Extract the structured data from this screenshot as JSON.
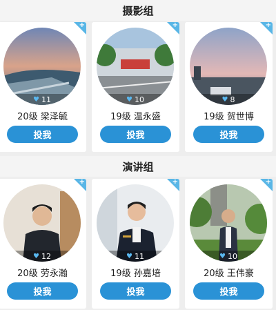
{
  "sections": [
    {
      "title": "摄影组",
      "cards": [
        {
          "likes": "11",
          "name": "20级 梁泽毓",
          "vote_label": "投我"
        },
        {
          "likes": "10",
          "name": "19级 温永盛",
          "vote_label": "投我"
        },
        {
          "likes": "8",
          "name": "19级 贺世博",
          "vote_label": "投我"
        }
      ]
    },
    {
      "title": "演讲组",
      "cards": [
        {
          "likes": "12",
          "name": "20级 劳永瀚",
          "vote_label": "投我"
        },
        {
          "likes": "11",
          "name": "19级 孙嘉培",
          "vote_label": "投我"
        },
        {
          "likes": "10",
          "name": "20级 王伟豪",
          "vote_label": "投我"
        }
      ]
    }
  ],
  "corner_icon": "+",
  "colors": {
    "accent": "#2a92d6",
    "corner": "#59b6e6",
    "heart": "#5ab8f0"
  }
}
